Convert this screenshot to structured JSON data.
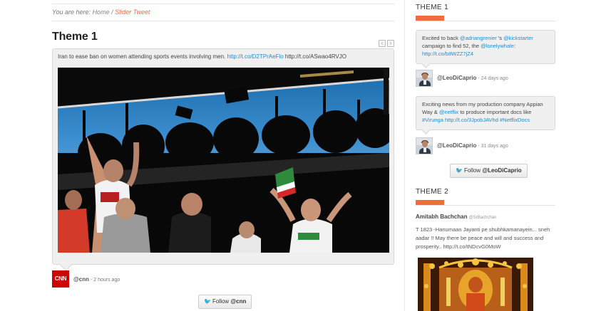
{
  "breadcrumb": {
    "prefix": "You are here:",
    "home": "Home",
    "separator": "/",
    "current": "Slider Tweet"
  },
  "main": {
    "title": "Theme 1",
    "nav": {
      "prev": "‹",
      "next": "›"
    },
    "tweet": {
      "text": "Iran to ease ban on women attending sports events involving men.",
      "link1": "http://t.co/D2TPrAeFlo",
      "link2": "http://t.co/ASwao4RVJO",
      "photo_alt": "Women fans cheering in a stadium holding Iranian flags"
    },
    "author": {
      "logo": "CNN",
      "handle": "@cnn",
      "time": " - 2 hours ago"
    },
    "follow": {
      "prefix": "Follow ",
      "handle": "@cnn"
    }
  },
  "sidebar": {
    "theme1": {
      "title": "THEME 1",
      "tweets": [
        {
          "parts": [
            {
              "text": "Excited to back ",
              "link": false
            },
            {
              "text": "@adriangrenier",
              "link": true
            },
            {
              "text": " 's ",
              "link": false
            },
            {
              "text": "@kickstarter",
              "link": true
            },
            {
              "text": " campaign to find 52, the ",
              "link": false
            },
            {
              "text": "@lonelywhale",
              "link": true
            },
            {
              "text": ": ",
              "link": false
            },
            {
              "text": "http://t.co/b8WZZ7jZ4",
              "link": true
            }
          ],
          "handle": "@LeoDiCaprio",
          "time": " - 24 days ago"
        },
        {
          "parts": [
            {
              "text": "Exciting news from my production company Appian Way & ",
              "link": false
            },
            {
              "text": "@netflix",
              "link": true
            },
            {
              "text": " to produce important docs like ",
              "link": false
            },
            {
              "text": "#Virunga",
              "link": true
            },
            {
              "text": " ",
              "link": false
            },
            {
              "text": "http://t.co/3JpobJAVhd",
              "link": true
            },
            {
              "text": " ",
              "link": false
            },
            {
              "text": "#NetflixDocs",
              "link": true
            }
          ],
          "handle": "@LeoDiCaprio",
          "time": " - 31 days ago"
        }
      ],
      "follow": {
        "prefix": "Follow ",
        "handle": "@LeoDiCaprio"
      }
    },
    "theme2": {
      "title": "THEME 2",
      "name": "Amitabh Bachchan",
      "sub_handle": "@SrBachchan",
      "text": "T 1823 -Hanumaan Jayanti pe shubhkamanayein... sneh aadar !! May there be peace and will and success and prosperity.. http://t.co/tNDcvG0MoW"
    }
  },
  "colors": {
    "accent": "#f26b3a",
    "link": "#1a8fd6",
    "cnn": "#cc0000"
  }
}
